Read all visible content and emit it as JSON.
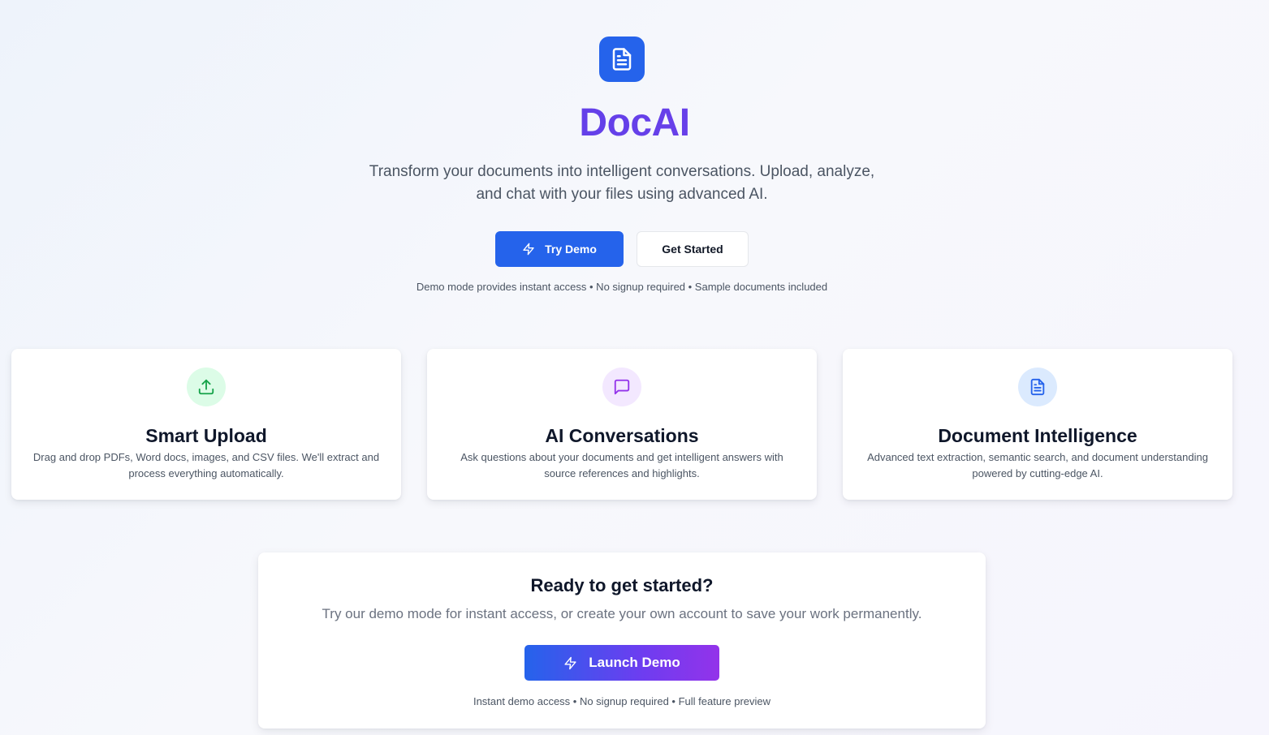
{
  "hero": {
    "logo_icon": "document-icon",
    "brand": "DocAI",
    "tagline_line1": "Transform your documents into intelligent conversations. Upload, analyze,",
    "tagline_line2": "and chat with your files using advanced AI.",
    "try_demo_label": "Try Demo",
    "get_started_label": "Get Started",
    "demo_note": "Demo mode provides instant access • No signup required • Sample documents included"
  },
  "features": [
    {
      "icon": "upload-icon",
      "title": "Smart Upload",
      "desc": "Drag and drop PDFs, Word docs, images, and CSV files. We'll extract and process everything automatically."
    },
    {
      "icon": "chat-bubble-icon",
      "title": "AI Conversations",
      "desc": "Ask questions about your documents and get intelligent answers with source references and highlights."
    },
    {
      "icon": "document-icon",
      "title": "Document Intelligence",
      "desc": "Advanced text extraction, semantic search, and document understanding powered by cutting-edge AI."
    }
  ],
  "cta": {
    "title": "Ready to get started?",
    "text": "Try our demo mode for instant access, or create your own account to save your work permanently.",
    "launch_label": "Launch Demo",
    "note": "Instant demo access • No signup required • Full feature preview"
  },
  "colors": {
    "primary": "#2563eb",
    "brand_gradient_start": "#4f46e5",
    "brand_gradient_end": "#7c3aed",
    "upload_bg": "#dcfce7",
    "upload_fg": "#16a34a",
    "chat_bg": "#f3e8ff",
    "chat_fg": "#9333ea",
    "doc_bg": "#dbeafe",
    "doc_fg": "#2563eb"
  }
}
